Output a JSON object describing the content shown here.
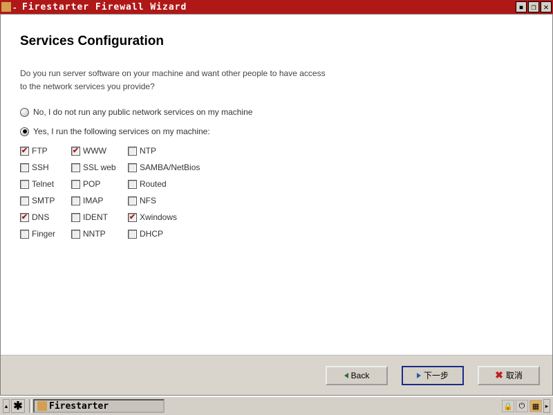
{
  "window": {
    "title": "Firestarter Firewall Wizard"
  },
  "page": {
    "title": "Services Configuration",
    "description_line1": "Do you run server software on your machine and want other people to have access",
    "description_line2": "to the network services you provide?"
  },
  "radios": {
    "no_label": "No, I do not run any public network services on my machine",
    "yes_label": "Yes, I run the following services on my machine:",
    "selected": "yes"
  },
  "services": [
    {
      "id": "ftp",
      "label": "FTP",
      "checked": true
    },
    {
      "id": "www",
      "label": "WWW",
      "checked": true
    },
    {
      "id": "ntp",
      "label": "NTP",
      "checked": false
    },
    {
      "id": "ssh",
      "label": "SSH",
      "checked": false
    },
    {
      "id": "sslweb",
      "label": "SSL web",
      "checked": false
    },
    {
      "id": "samba",
      "label": "SAMBA/NetBios",
      "checked": false
    },
    {
      "id": "telnet",
      "label": "Telnet",
      "checked": false
    },
    {
      "id": "pop",
      "label": "POP",
      "checked": false
    },
    {
      "id": "routed",
      "label": "Routed",
      "checked": false
    },
    {
      "id": "smtp",
      "label": "SMTP",
      "checked": false
    },
    {
      "id": "imap",
      "label": "IMAP",
      "checked": false
    },
    {
      "id": "nfs",
      "label": "NFS",
      "checked": false
    },
    {
      "id": "dns",
      "label": "DNS",
      "checked": true
    },
    {
      "id": "ident",
      "label": "IDENT",
      "checked": false
    },
    {
      "id": "xwin",
      "label": "Xwindows",
      "checked": true
    },
    {
      "id": "finger",
      "label": "Finger",
      "checked": false
    },
    {
      "id": "nntp",
      "label": "NNTP",
      "checked": false
    },
    {
      "id": "dhcp",
      "label": "DHCP",
      "checked": false
    }
  ],
  "buttons": {
    "back": "Back",
    "next": "下一步",
    "cancel": "取消"
  },
  "taskbar": {
    "task_label": "Firestarter"
  }
}
